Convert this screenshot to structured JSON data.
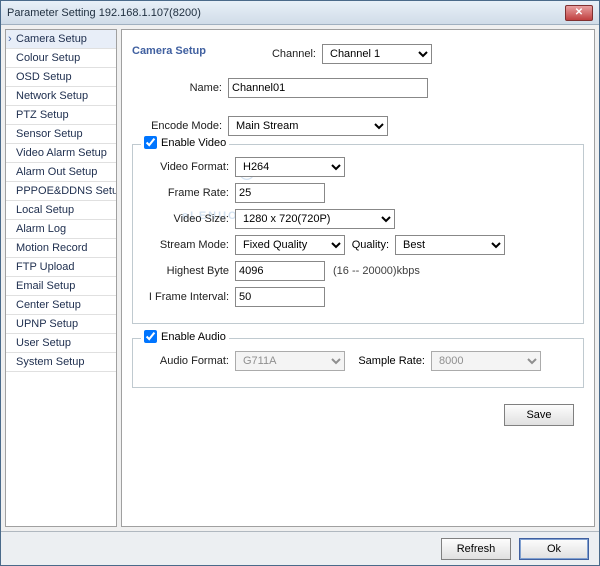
{
  "window": {
    "title": "Parameter Setting 192.168.1.107(8200)"
  },
  "sidebar": {
    "items": [
      "Camera Setup",
      "Colour Setup",
      "OSD Setup",
      "Network Setup",
      "PTZ Setup",
      "Sensor Setup",
      "Video Alarm Setup",
      "Alarm Out Setup",
      "PPPOE&DDNS Setup",
      "Local Setup",
      "Alarm Log",
      "Motion Record",
      "FTP Upload",
      "Email Setup",
      "Center Setup",
      "UPNP Setup",
      "User Setup",
      "System Setup"
    ],
    "active_index": 0
  },
  "section_title": "Camera Setup",
  "labels": {
    "channel": "Channel:",
    "name": "Name:",
    "encode_mode": "Encode Mode:",
    "enable_video": "Enable Video",
    "video_format": "Video Format:",
    "frame_rate": "Frame Rate:",
    "video_size": "Video Size:",
    "stream_mode": "Stream Mode:",
    "quality": "Quality:",
    "highest_byte": "Highest Byte",
    "iframe_interval": "I Frame Interval:",
    "enable_audio": "Enable Audio",
    "audio_format": "Audio Format:",
    "sample_rate": "Sample Rate:",
    "kbps_range": "(16 -- 20000)kbps",
    "save": "Save",
    "refresh": "Refresh",
    "ok": "Ok"
  },
  "values": {
    "channel": "Channel 1",
    "name": "Channel01",
    "encode_mode": "Main Stream",
    "enable_video": true,
    "video_format": "H264",
    "frame_rate": "25",
    "video_size": "1280 x 720(720P)",
    "stream_mode": "Fixed Quality",
    "quality": "Best",
    "highest_byte": "4096",
    "iframe_interval": "50",
    "enable_audio": true,
    "audio_format": "G711A",
    "sample_rate": "8000"
  },
  "watermark": "eLENUO"
}
